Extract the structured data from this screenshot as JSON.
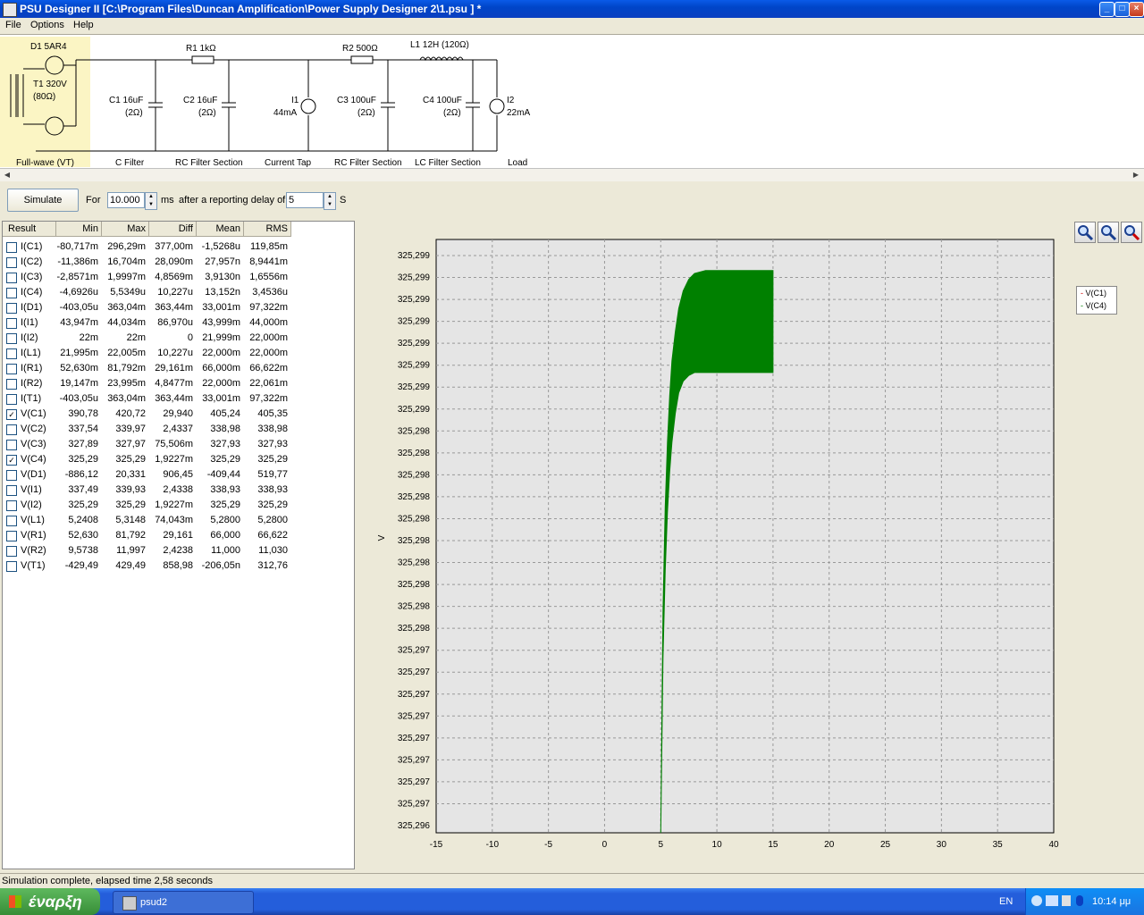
{
  "window": {
    "title": "PSU Designer II  [C:\\Program Files\\Duncan Amplification\\Power Supply Designer 2\\1.psu ] *",
    "min": "_",
    "max": "□",
    "close": "×"
  },
  "menu": [
    "File",
    "Options",
    "Help"
  ],
  "schematic": {
    "components": {
      "d1": "D1 5AR4",
      "t1": "T1 320V",
      "t1r": "(80Ω)",
      "r1": "R1 1kΩ",
      "c1": "C1 16uF",
      "c1r": "(2Ω)",
      "c2": "C2 16uF",
      "c2r": "(2Ω)",
      "i1": "I1",
      "i1v": "44mA",
      "r2": "R2 500Ω",
      "c3": "C3 100uF",
      "c3r": "(2Ω)",
      "l1": "L1 12H (120Ω)",
      "c4": "C4 100uF",
      "c4r": "(2Ω)",
      "i2": "I2",
      "i2v": "22mA"
    },
    "sections": [
      "Full-wave (VT)",
      "C Filter",
      "RC Filter Section",
      "Current Tap",
      "RC Filter Section",
      "LC Filter Section",
      "Load"
    ]
  },
  "toolbar": {
    "simulate": "Simulate",
    "for_label": "For",
    "duration": "10.000",
    "ms": "ms",
    "delay_label": "after a reporting delay of",
    "delay": "5",
    "s": "S"
  },
  "table": {
    "headers": [
      "Result",
      "Min",
      "Max",
      "Diff",
      "Mean",
      "RMS"
    ],
    "rows": [
      {
        "checked": false,
        "name": "I(C1)",
        "min": "-80,717m",
        "max": "296,29m",
        "diff": "377,00m",
        "mean": "-1,5268u",
        "rms": "119,85m"
      },
      {
        "checked": false,
        "name": "I(C2)",
        "min": "-11,386m",
        "max": "16,704m",
        "diff": "28,090m",
        "mean": "27,957n",
        "rms": "8,9441m"
      },
      {
        "checked": false,
        "name": "I(C3)",
        "min": "-2,8571m",
        "max": "1,9997m",
        "diff": "4,8569m",
        "mean": "3,9130n",
        "rms": "1,6556m"
      },
      {
        "checked": false,
        "name": "I(C4)",
        "min": "-4,6926u",
        "max": "5,5349u",
        "diff": "10,227u",
        "mean": "13,152n",
        "rms": "3,4536u"
      },
      {
        "checked": false,
        "name": "I(D1)",
        "min": "-403,05u",
        "max": "363,04m",
        "diff": "363,44m",
        "mean": "33,001m",
        "rms": "97,322m"
      },
      {
        "checked": false,
        "name": "I(I1)",
        "min": "43,947m",
        "max": "44,034m",
        "diff": "86,970u",
        "mean": "43,999m",
        "rms": "44,000m"
      },
      {
        "checked": false,
        "name": "I(I2)",
        "min": "22m",
        "max": "22m",
        "diff": "0",
        "mean": "21,999m",
        "rms": "22,000m"
      },
      {
        "checked": false,
        "name": "I(L1)",
        "min": "21,995m",
        "max": "22,005m",
        "diff": "10,227u",
        "mean": "22,000m",
        "rms": "22,000m"
      },
      {
        "checked": false,
        "name": "I(R1)",
        "min": "52,630m",
        "max": "81,792m",
        "diff": "29,161m",
        "mean": "66,000m",
        "rms": "66,622m"
      },
      {
        "checked": false,
        "name": "I(R2)",
        "min": "19,147m",
        "max": "23,995m",
        "diff": "4,8477m",
        "mean": "22,000m",
        "rms": "22,061m"
      },
      {
        "checked": false,
        "name": "I(T1)",
        "min": "-403,05u",
        "max": "363,04m",
        "diff": "363,44m",
        "mean": "33,001m",
        "rms": "97,322m"
      },
      {
        "checked": true,
        "name": "V(C1)",
        "min": "390,78",
        "max": "420,72",
        "diff": "29,940",
        "mean": "405,24",
        "rms": "405,35"
      },
      {
        "checked": false,
        "name": "V(C2)",
        "min": "337,54",
        "max": "339,97",
        "diff": "2,4337",
        "mean": "338,98",
        "rms": "338,98"
      },
      {
        "checked": false,
        "name": "V(C3)",
        "min": "327,89",
        "max": "327,97",
        "diff": "75,506m",
        "mean": "327,93",
        "rms": "327,93"
      },
      {
        "checked": true,
        "name": "V(C4)",
        "min": "325,29",
        "max": "325,29",
        "diff": "1,9227m",
        "mean": "325,29",
        "rms": "325,29"
      },
      {
        "checked": false,
        "name": "V(D1)",
        "min": "-886,12",
        "max": "20,331",
        "diff": "906,45",
        "mean": "-409,44",
        "rms": "519,77"
      },
      {
        "checked": false,
        "name": "V(I1)",
        "min": "337,49",
        "max": "339,93",
        "diff": "2,4338",
        "mean": "338,93",
        "rms": "338,93"
      },
      {
        "checked": false,
        "name": "V(I2)",
        "min": "325,29",
        "max": "325,29",
        "diff": "1,9227m",
        "mean": "325,29",
        "rms": "325,29"
      },
      {
        "checked": false,
        "name": "V(L1)",
        "min": "5,2408",
        "max": "5,3148",
        "diff": "74,043m",
        "mean": "5,2800",
        "rms": "5,2800"
      },
      {
        "checked": false,
        "name": "V(R1)",
        "min": "52,630",
        "max": "81,792",
        "diff": "29,161",
        "mean": "66,000",
        "rms": "66,622"
      },
      {
        "checked": false,
        "name": "V(R2)",
        "min": "9,5738",
        "max": "11,997",
        "diff": "2,4238",
        "mean": "11,000",
        "rms": "11,030"
      },
      {
        "checked": false,
        "name": "V(T1)",
        "min": "-429,49",
        "max": "429,49",
        "diff": "858,98",
        "mean": "-206,05n",
        "rms": "312,76"
      }
    ]
  },
  "chart_data": {
    "type": "area",
    "ylabel": "V",
    "xlim": [
      -15,
      40
    ],
    "x_ticks": [
      "-15",
      "-10",
      "-5",
      "0",
      "5",
      "10",
      "15",
      "20",
      "25",
      "30",
      "35",
      "40"
    ],
    "y_ticks": [
      "325,299",
      "325,299",
      "325,299",
      "325,299",
      "325,299",
      "325,299",
      "325,299",
      "325,299",
      "325,298",
      "325,298",
      "325,298",
      "325,298",
      "325,298",
      "325,298",
      "325,298",
      "325,298",
      "325,298",
      "325,298",
      "325,297",
      "325,297",
      "325,297",
      "325,297",
      "325,297",
      "325,297",
      "325,297",
      "325,297",
      "325,296"
    ],
    "grid": true,
    "legend": [
      "V(C1)",
      "V(C4)"
    ],
    "legend_position": "right",
    "series_color": "#008000",
    "envelope": {
      "x": [
        5.0,
        5.2,
        5.4,
        5.6,
        5.8,
        6.0,
        6.3,
        6.6,
        7.0,
        7.5,
        8.0,
        9.0,
        10.0,
        15.0
      ],
      "upper": [
        0.0,
        0.38,
        0.56,
        0.67,
        0.75,
        0.81,
        0.86,
        0.9,
        0.93,
        0.95,
        0.96,
        0.965,
        0.965,
        0.965
      ],
      "lower": [
        0.0,
        0.3,
        0.45,
        0.55,
        0.62,
        0.67,
        0.72,
        0.755,
        0.775,
        0.785,
        0.79,
        0.79,
        0.79,
        0.79
      ]
    }
  },
  "status": "Simulation complete, elapsed time 2,58 seconds",
  "taskbar": {
    "start": "έναρξη",
    "item": "psud2",
    "lang": "EN",
    "time": "10:14 μμ"
  }
}
